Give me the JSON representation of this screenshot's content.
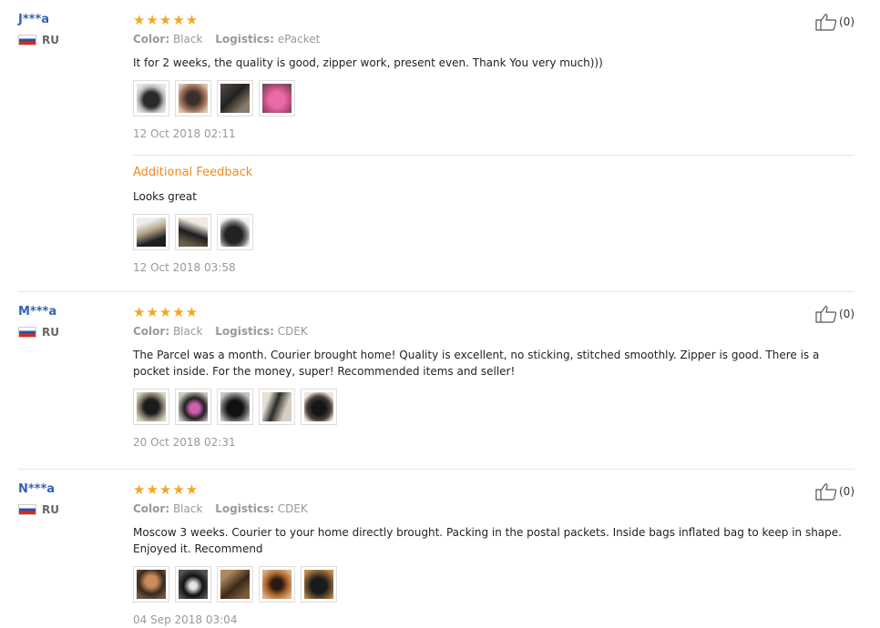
{
  "reviews": [
    {
      "user": "J***a",
      "country": "RU",
      "rating": "★★★★★",
      "color_label": "Color:",
      "color_value": "Black",
      "logistics_label": "Logistics:",
      "logistics_value": "ePacket",
      "text": "It for 2 weeks, the quality is good, zipper work, present even. Thank You very much)))",
      "date": "12 Oct 2018 02:11",
      "likes": "(0)",
      "additional": {
        "label": "Additional Feedback",
        "text": "Looks great",
        "date": "12 Oct 2018 03:58"
      }
    },
    {
      "user": "M***a",
      "country": "RU",
      "rating": "★★★★★",
      "color_label": "Color:",
      "color_value": "Black",
      "logistics_label": "Logistics:",
      "logistics_value": "CDEK",
      "text": "The Parcel was a month. Courier brought home! Quality is excellent, no sticking, stitched smoothly. Zipper is good. There is a pocket inside. For the money, super! Recommended items and seller!",
      "date": "20 Oct 2018 02:31",
      "likes": "(0)"
    },
    {
      "user": "N***a",
      "country": "RU",
      "rating": "★★★★★",
      "color_label": "Color:",
      "color_value": "Black",
      "logistics_label": "Logistics:",
      "logistics_value": "CDEK",
      "text": "Moscow 3 weeks. Courier to your home directly brought. Packing in the postal packets. Inside bags inflated bag to keep in shape. Enjoyed it. Recommend",
      "date": "04 Sep 2018 03:04",
      "likes": "(0)"
    }
  ]
}
